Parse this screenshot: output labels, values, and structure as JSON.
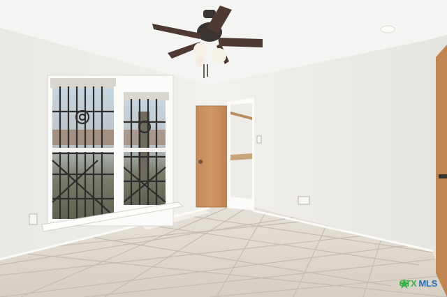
{
  "image": {
    "description_tag": "empty-bedroom-listing-photo",
    "watermark": {
      "left": "CTX",
      "right": "MLS",
      "left_color": "#38b24a",
      "right_color": "#1f6fc0",
      "icon": "star-icon"
    },
    "colors": {
      "wall": "#efeeeb",
      "ceiling": "#f4f4f2",
      "floor_tile": "#dcd6cc",
      "grout": "#c9c2b6",
      "door_wood": "#c98e5b",
      "trim": "#fbfbfa",
      "fan_blade": "#4e3a33",
      "fan_light": "#f5f1e4"
    }
  }
}
